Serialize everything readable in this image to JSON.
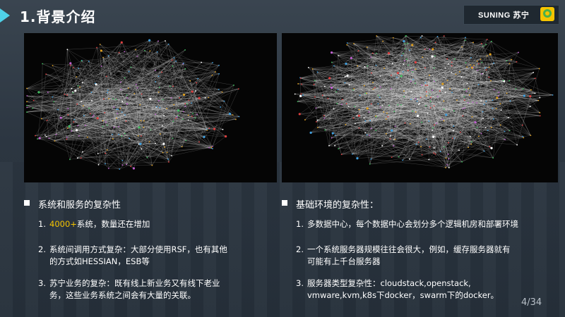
{
  "header": {
    "title": "1.背景介绍",
    "brand_text": "SUNING 苏宁"
  },
  "panels": {
    "left": {
      "kind": "network-graph"
    },
    "right": {
      "kind": "network-graph"
    }
  },
  "left_section": {
    "title": "系统和服务的复杂性",
    "items": [
      {
        "num": "1.",
        "highlight": "4000+",
        "text": "系统，数量还在增加"
      },
      {
        "num": "2.",
        "line1": "系统间调用方式复杂：大部分使用RSF，也有其他",
        "line2": "的方式如HESSIAN，ESB等"
      },
      {
        "num": "3.",
        "line1": "苏宁业务的复杂：既有线上新业务又有线下老业",
        "line2": "务，这些业务系统之间会有大量的关联。"
      }
    ]
  },
  "right_section": {
    "title": "基础环境的复杂性：",
    "items": [
      {
        "num": "1.",
        "line1": "多数据中心，每个数据中心会划分多个逻辑机房和部署环境"
      },
      {
        "num": "2.",
        "line1": "一个系统服务器规模往往会很大，例如，缓存服务器就有",
        "line2": "可能有上千台服务器"
      },
      {
        "num": "3.",
        "line1": "服务器类型复杂性：cloudstack,openstack,",
        "line2": "vmware,kvm,k8s下docker，swarm下的docker。"
      }
    ]
  },
  "footer": {
    "page_number": "4/34"
  },
  "colors": {
    "accent": "#4fd1e8",
    "highlight": "#f5c400",
    "background": "#2b3540"
  }
}
